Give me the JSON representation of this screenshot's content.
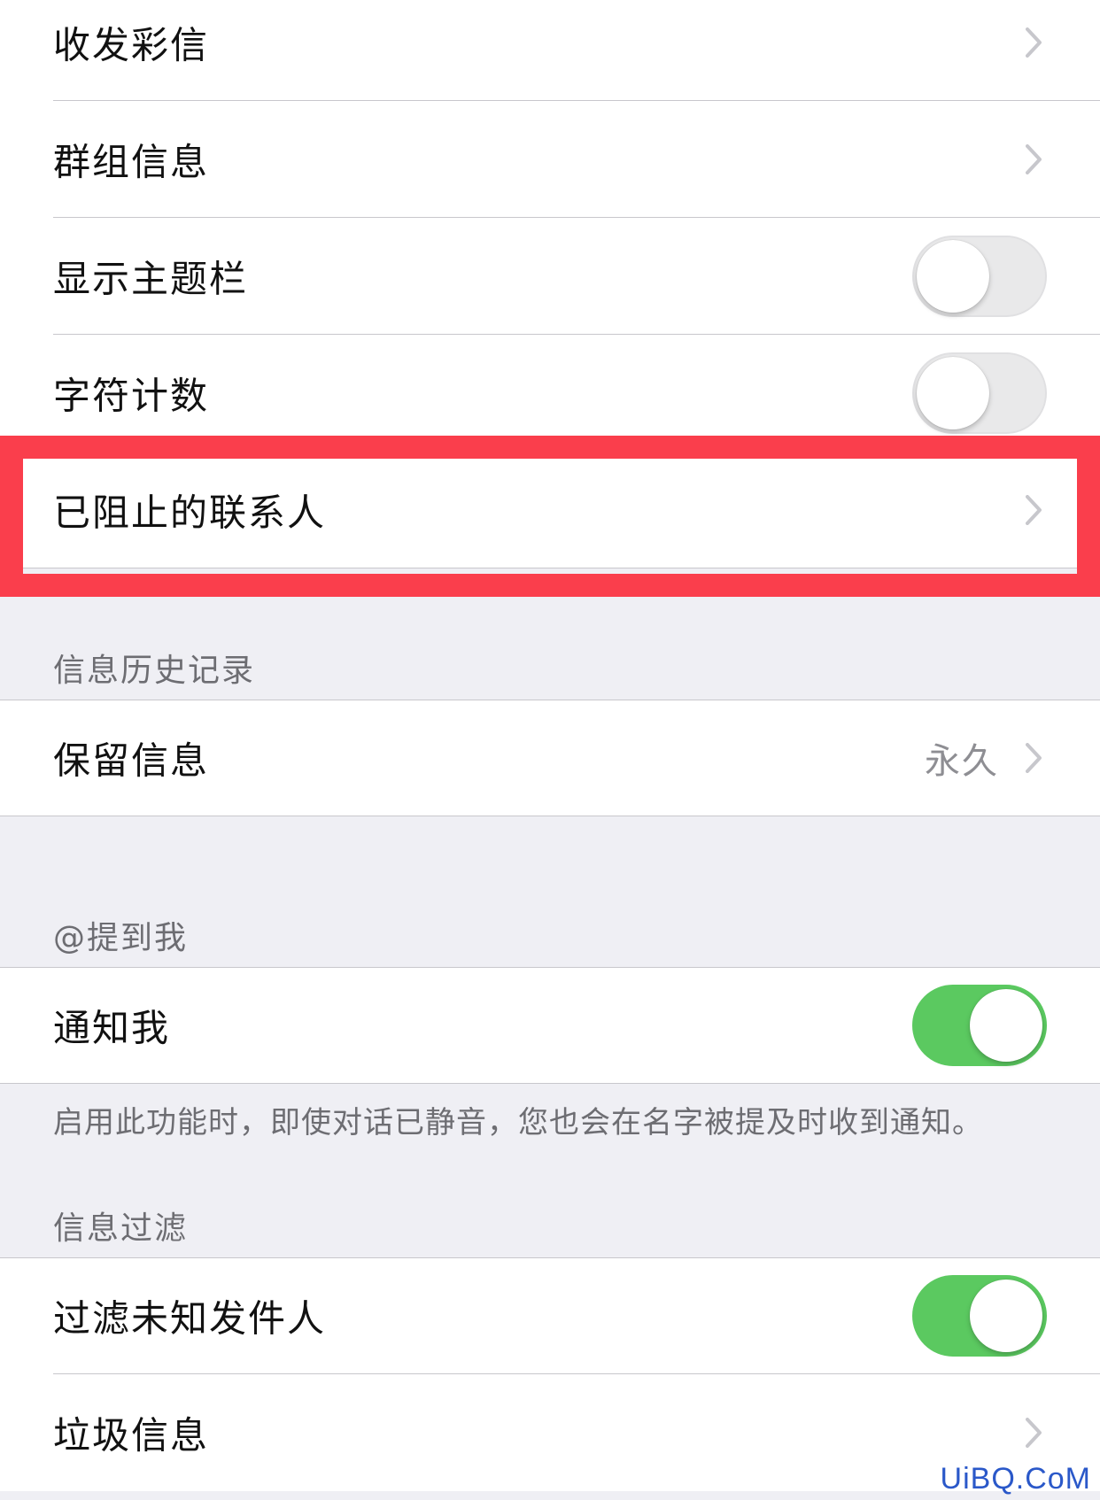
{
  "group_main": {
    "items": [
      {
        "label": "收发彩信",
        "control": "chevron"
      },
      {
        "label": "群组信息",
        "control": "chevron"
      },
      {
        "label": "显示主题栏",
        "control": "toggle",
        "on": false
      },
      {
        "label": "字符计数",
        "control": "toggle",
        "on": false
      },
      {
        "label": "已阻止的联系人",
        "control": "chevron",
        "highlighted": true
      }
    ]
  },
  "history": {
    "header": "信息历史记录",
    "keep_label": "保留信息",
    "keep_value": "永久"
  },
  "mentions": {
    "header": "@提到我",
    "notify_label": "通知我",
    "notify_on": true,
    "footer": "启用此功能时，即使对话已静音，您也会在名字被提及时收到通知。"
  },
  "filter": {
    "header": "信息过滤",
    "unknown_label": "过滤未知发件人",
    "unknown_on": true,
    "junk_label": "垃圾信息"
  },
  "watermark": "UiBQ.CoM",
  "colors": {
    "toggle_on": "#5bc960",
    "highlight": "#fa3e4c",
    "background": "#efeff4"
  }
}
